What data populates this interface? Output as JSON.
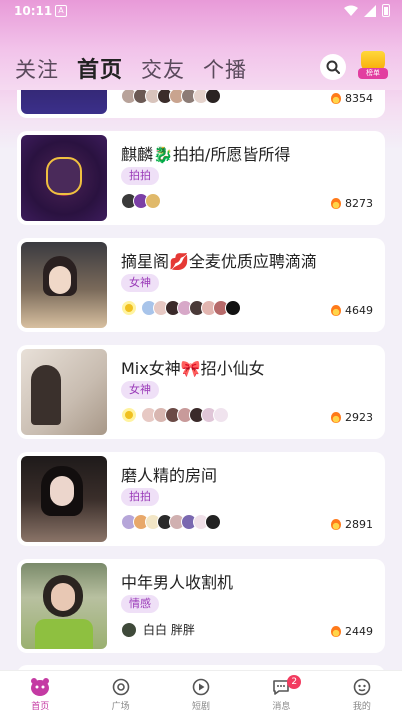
{
  "status_bar": {
    "time": "10:11",
    "sim": "A"
  },
  "nav": {
    "tabs": [
      {
        "label": "关注"
      },
      {
        "label": "首页"
      },
      {
        "label": "交友"
      },
      {
        "label": "个播"
      }
    ],
    "active_tab": "首页",
    "rank_label": "榜单"
  },
  "rooms": [
    {
      "title": "",
      "tag": "",
      "heat": "8354",
      "avatar_colors": [
        "#b8a39a",
        "#6b5a54",
        "#d8c4bc",
        "#3b2d2a",
        "#c9a48f",
        "#8c7c76",
        "#e4d2cb",
        "#2a2322"
      ]
    },
    {
      "title": "麒麟🐉拍拍/所愿皆所得",
      "tag": "拍拍",
      "heat": "8273",
      "avatar_colors": [
        "#3a3a3a",
        "#7b3fa6",
        "#e0b96a"
      ]
    },
    {
      "title": "摘星阁💋全麦优质应聘滴滴",
      "tag": "女神",
      "heat": "4649",
      "avatar_colors": [
        "#fff3a0",
        "#a8c4ea",
        "#e7c9c4",
        "#3a2a2a",
        "#d7a8c8",
        "#4a3a38",
        "#e2b5b0",
        "#b76a6a",
        "#111111"
      ]
    },
    {
      "title": "Mix女神🎀招小仙女",
      "tag": "女神",
      "heat": "2923",
      "avatar_colors": [
        "#fff3a0",
        "#e7c9c4",
        "#d8b6b0",
        "#6b4a46",
        "#c89a9a",
        "#3a2a2a",
        "#e0c6d8",
        "#f0e3ee"
      ]
    },
    {
      "title": "磨人精的房间",
      "tag": "拍拍",
      "heat": "2891",
      "avatar_colors": [
        "#b6a6d9",
        "#e8a86a",
        "#f2e6c6",
        "#2a2a2a",
        "#d0b0b0",
        "#7a68b0",
        "#f0e0e8",
        "#222222"
      ]
    },
    {
      "title": "中年男人收割机",
      "tag": "情感",
      "heat": "2449",
      "owner": "白白 胖胖",
      "avatar_colors": [
        "#3f4a3a"
      ]
    }
  ],
  "bottom_tabs": [
    {
      "label": "首页",
      "icon": "home-mascot-icon",
      "active": true
    },
    {
      "label": "广场",
      "icon": "plaza-icon",
      "active": false
    },
    {
      "label": "短剧",
      "icon": "play-icon",
      "active": false
    },
    {
      "label": "消息",
      "icon": "message-icon",
      "active": false,
      "badge": "2"
    },
    {
      "label": "我的",
      "icon": "profile-icon",
      "active": false
    }
  ],
  "colors": {
    "accent": "#c43aa3",
    "tag_bg": "#efe0f7",
    "tag_text": "#9a3ab8",
    "badge": "#f23b5f"
  }
}
